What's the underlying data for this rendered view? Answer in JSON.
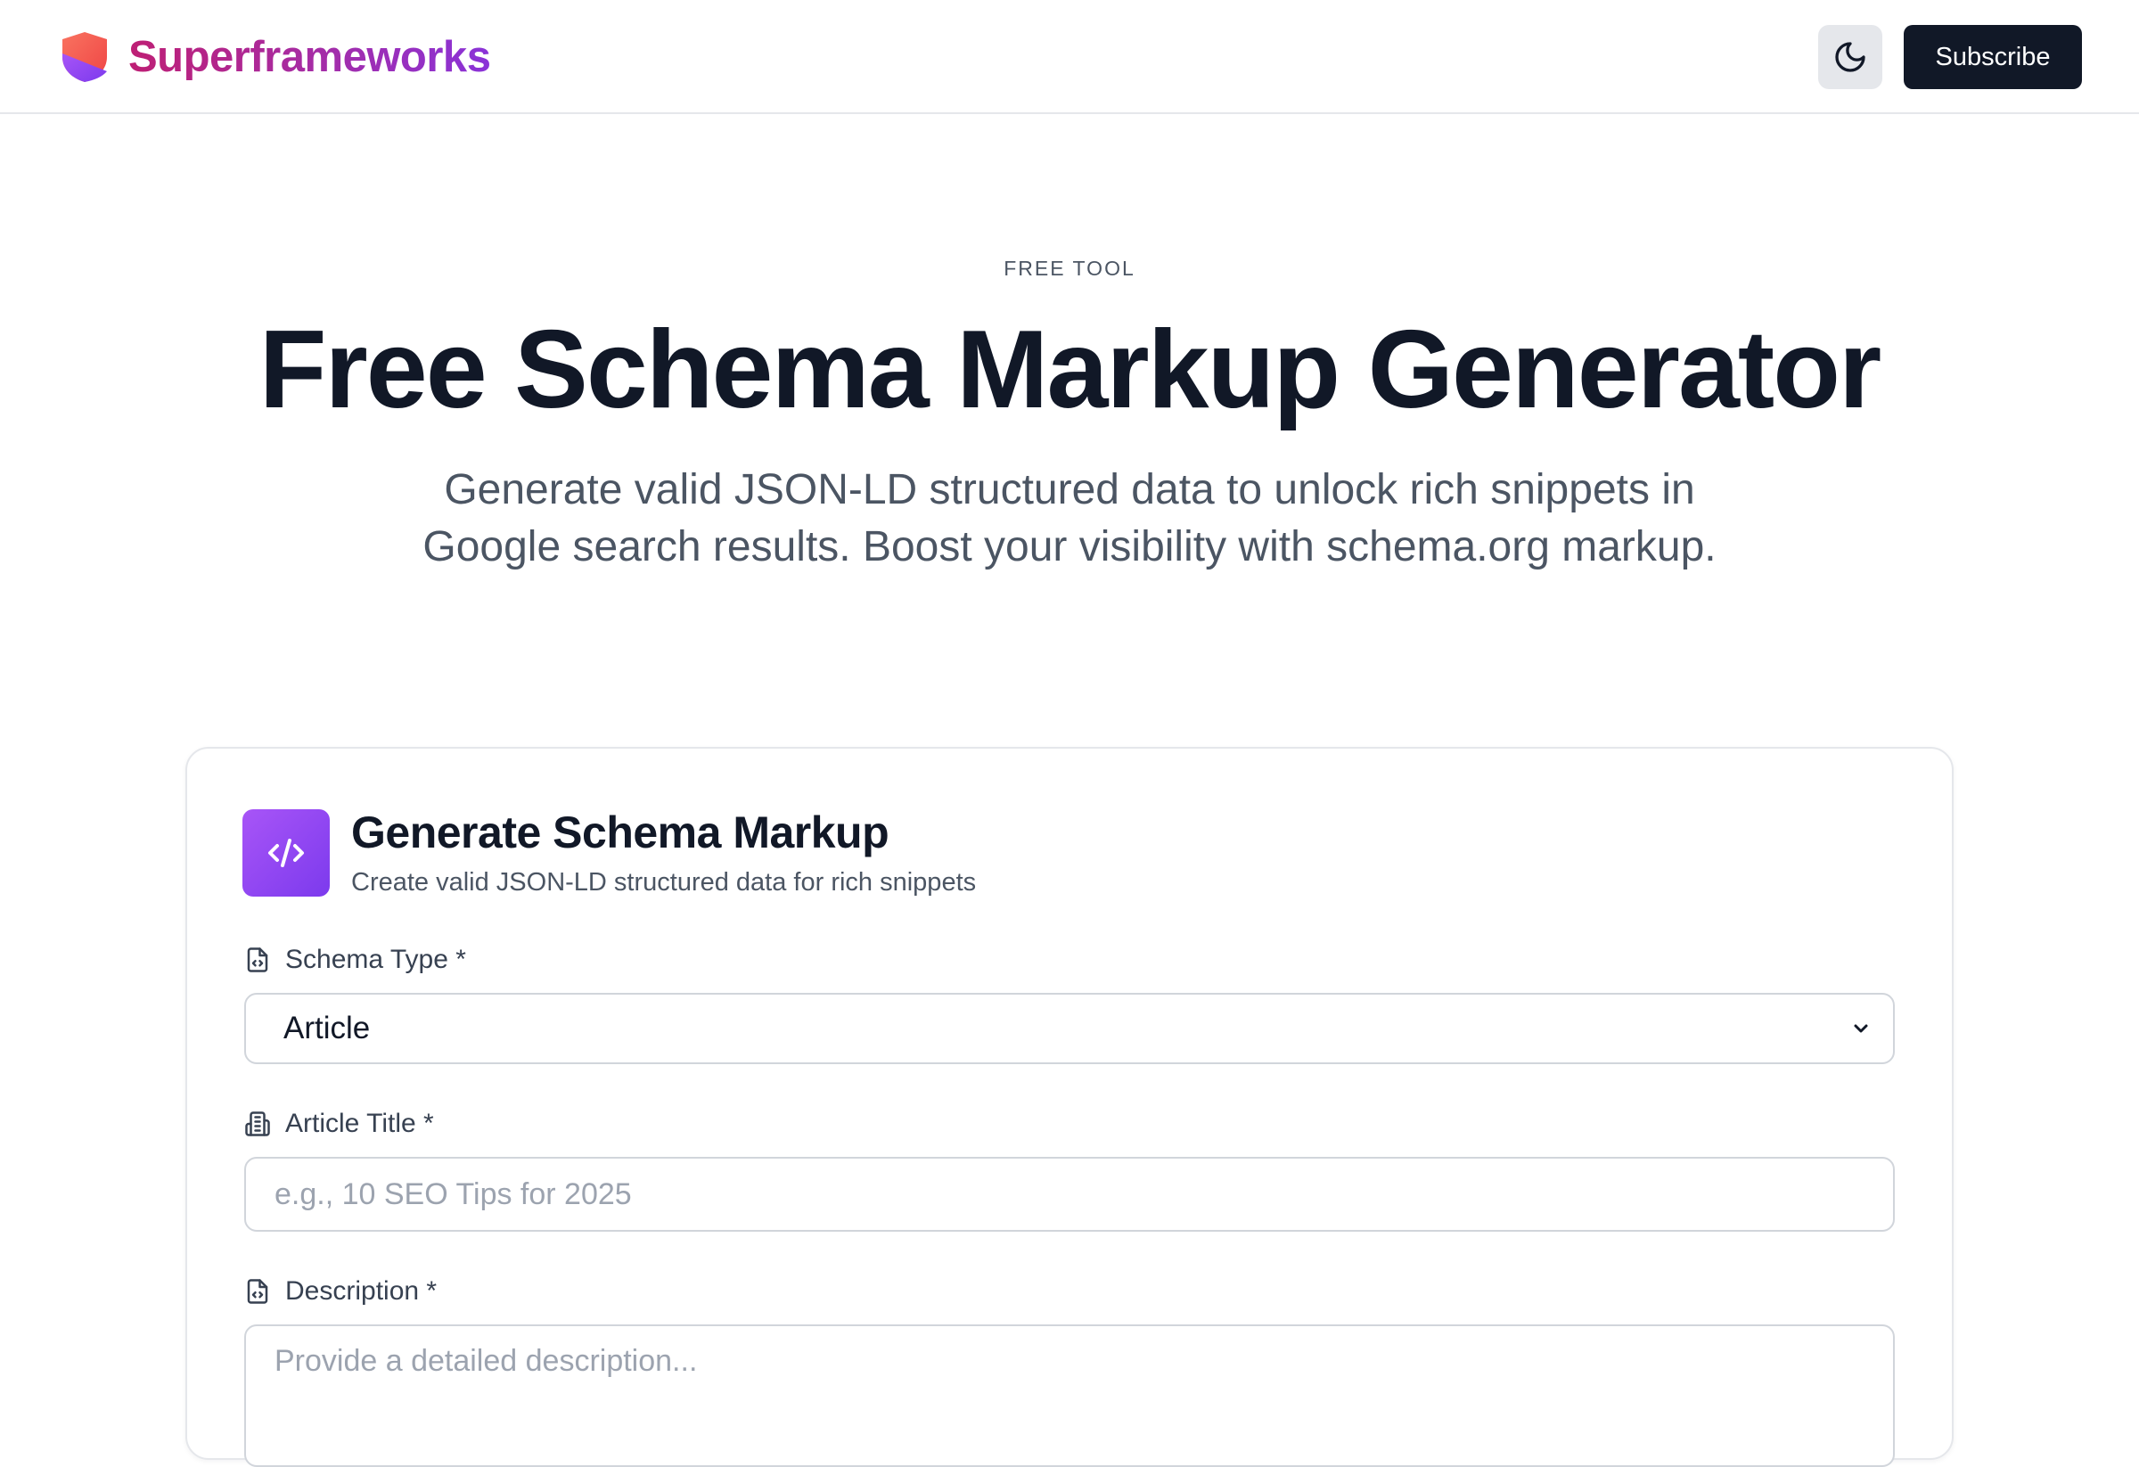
{
  "header": {
    "brand_name": "Superframeworks",
    "brand_logo_icon": "shield-icon",
    "theme_toggle_icon": "moon-icon",
    "subscribe_label": "Subscribe"
  },
  "hero": {
    "eyebrow": "FREE TOOL",
    "title": "Free Schema Markup Generator",
    "subtitle": "Generate valid JSON-LD structured data to unlock rich snippets in Google search results. Boost your visibility with schema.org markup."
  },
  "card": {
    "icon": "code-icon",
    "title": "Generate Schema Markup",
    "subtitle": "Create valid JSON-LD structured data for rich snippets",
    "fields": {
      "schema_type": {
        "label": "Schema Type *",
        "icon": "file-code-icon",
        "value": "Article"
      },
      "article_title": {
        "label": "Article Title *",
        "icon": "building-icon",
        "value": "",
        "placeholder": "e.g., 10 SEO Tips for 2025"
      },
      "description": {
        "label": "Description *",
        "icon": "file-code-icon",
        "value": "",
        "placeholder": "Provide a detailed description..."
      }
    }
  },
  "colors": {
    "brand_gradient_start": "#be1f74",
    "brand_gradient_end": "#8a33d8",
    "primary_dark": "#111827",
    "accent_purple": "#8b5cf6"
  }
}
